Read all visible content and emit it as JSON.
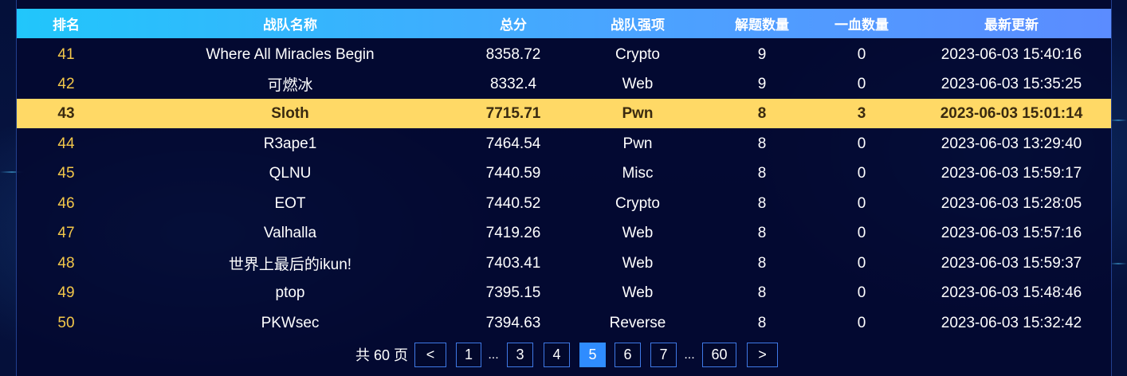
{
  "table": {
    "headers": {
      "rank": "排名",
      "team_name": "战队名称",
      "score": "总分",
      "strength": "战队强项",
      "solved": "解题数量",
      "first_blood": "一血数量",
      "updated": "最新更新"
    },
    "rows": [
      {
        "rank": "41",
        "team_name": "Where All Miracles Begin",
        "score": "8358.72",
        "strength": "Crypto",
        "solved": "9",
        "first_blood": "0",
        "updated": "2023-06-03 15:40:16"
      },
      {
        "rank": "42",
        "team_name": "可燃冰",
        "score": "8332.4",
        "strength": "Web",
        "solved": "9",
        "first_blood": "0",
        "updated": "2023-06-03 15:35:25"
      },
      {
        "rank": "43",
        "team_name": "Sloth",
        "score": "7715.71",
        "strength": "Pwn",
        "solved": "8",
        "first_blood": "3",
        "updated": "2023-06-03 15:01:14",
        "highlighted": true
      },
      {
        "rank": "44",
        "team_name": "R3ape1",
        "score": "7464.54",
        "strength": "Pwn",
        "solved": "8",
        "first_blood": "0",
        "updated": "2023-06-03 13:29:40"
      },
      {
        "rank": "45",
        "team_name": "QLNU",
        "score": "7440.59",
        "strength": "Misc",
        "solved": "8",
        "first_blood": "0",
        "updated": "2023-06-03 15:59:17"
      },
      {
        "rank": "46",
        "team_name": "EOT",
        "score": "7440.52",
        "strength": "Crypto",
        "solved": "8",
        "first_blood": "0",
        "updated": "2023-06-03 15:28:05"
      },
      {
        "rank": "47",
        "team_name": "Valhalla",
        "score": "7419.26",
        "strength": "Web",
        "solved": "8",
        "first_blood": "0",
        "updated": "2023-06-03 15:57:16"
      },
      {
        "rank": "48",
        "team_name": "世界上最后的ikun!",
        "score": "7403.41",
        "strength": "Web",
        "solved": "8",
        "first_blood": "0",
        "updated": "2023-06-03 15:59:37"
      },
      {
        "rank": "49",
        "team_name": "ptop",
        "score": "7395.15",
        "strength": "Web",
        "solved": "8",
        "first_blood": "0",
        "updated": "2023-06-03 15:48:46"
      },
      {
        "rank": "50",
        "team_name": "PKWsec",
        "score": "7394.63",
        "strength": "Reverse",
        "solved": "8",
        "first_blood": "0",
        "updated": "2023-06-03 15:32:42"
      }
    ]
  },
  "pagination": {
    "total_text": "共 60 页",
    "prev_label": "<",
    "next_label": ">",
    "ellipsis": "...",
    "pages": [
      "1",
      "3",
      "4",
      "5",
      "6",
      "7",
      "60"
    ],
    "current": "5"
  },
  "colors": {
    "header_gradient_start": "#21c6fb",
    "header_gradient_end": "#5b8cff",
    "rank_text": "#f4c84a",
    "highlight_row": "#ffd966",
    "active_page": "#2f8cff",
    "background": "#04103a"
  }
}
